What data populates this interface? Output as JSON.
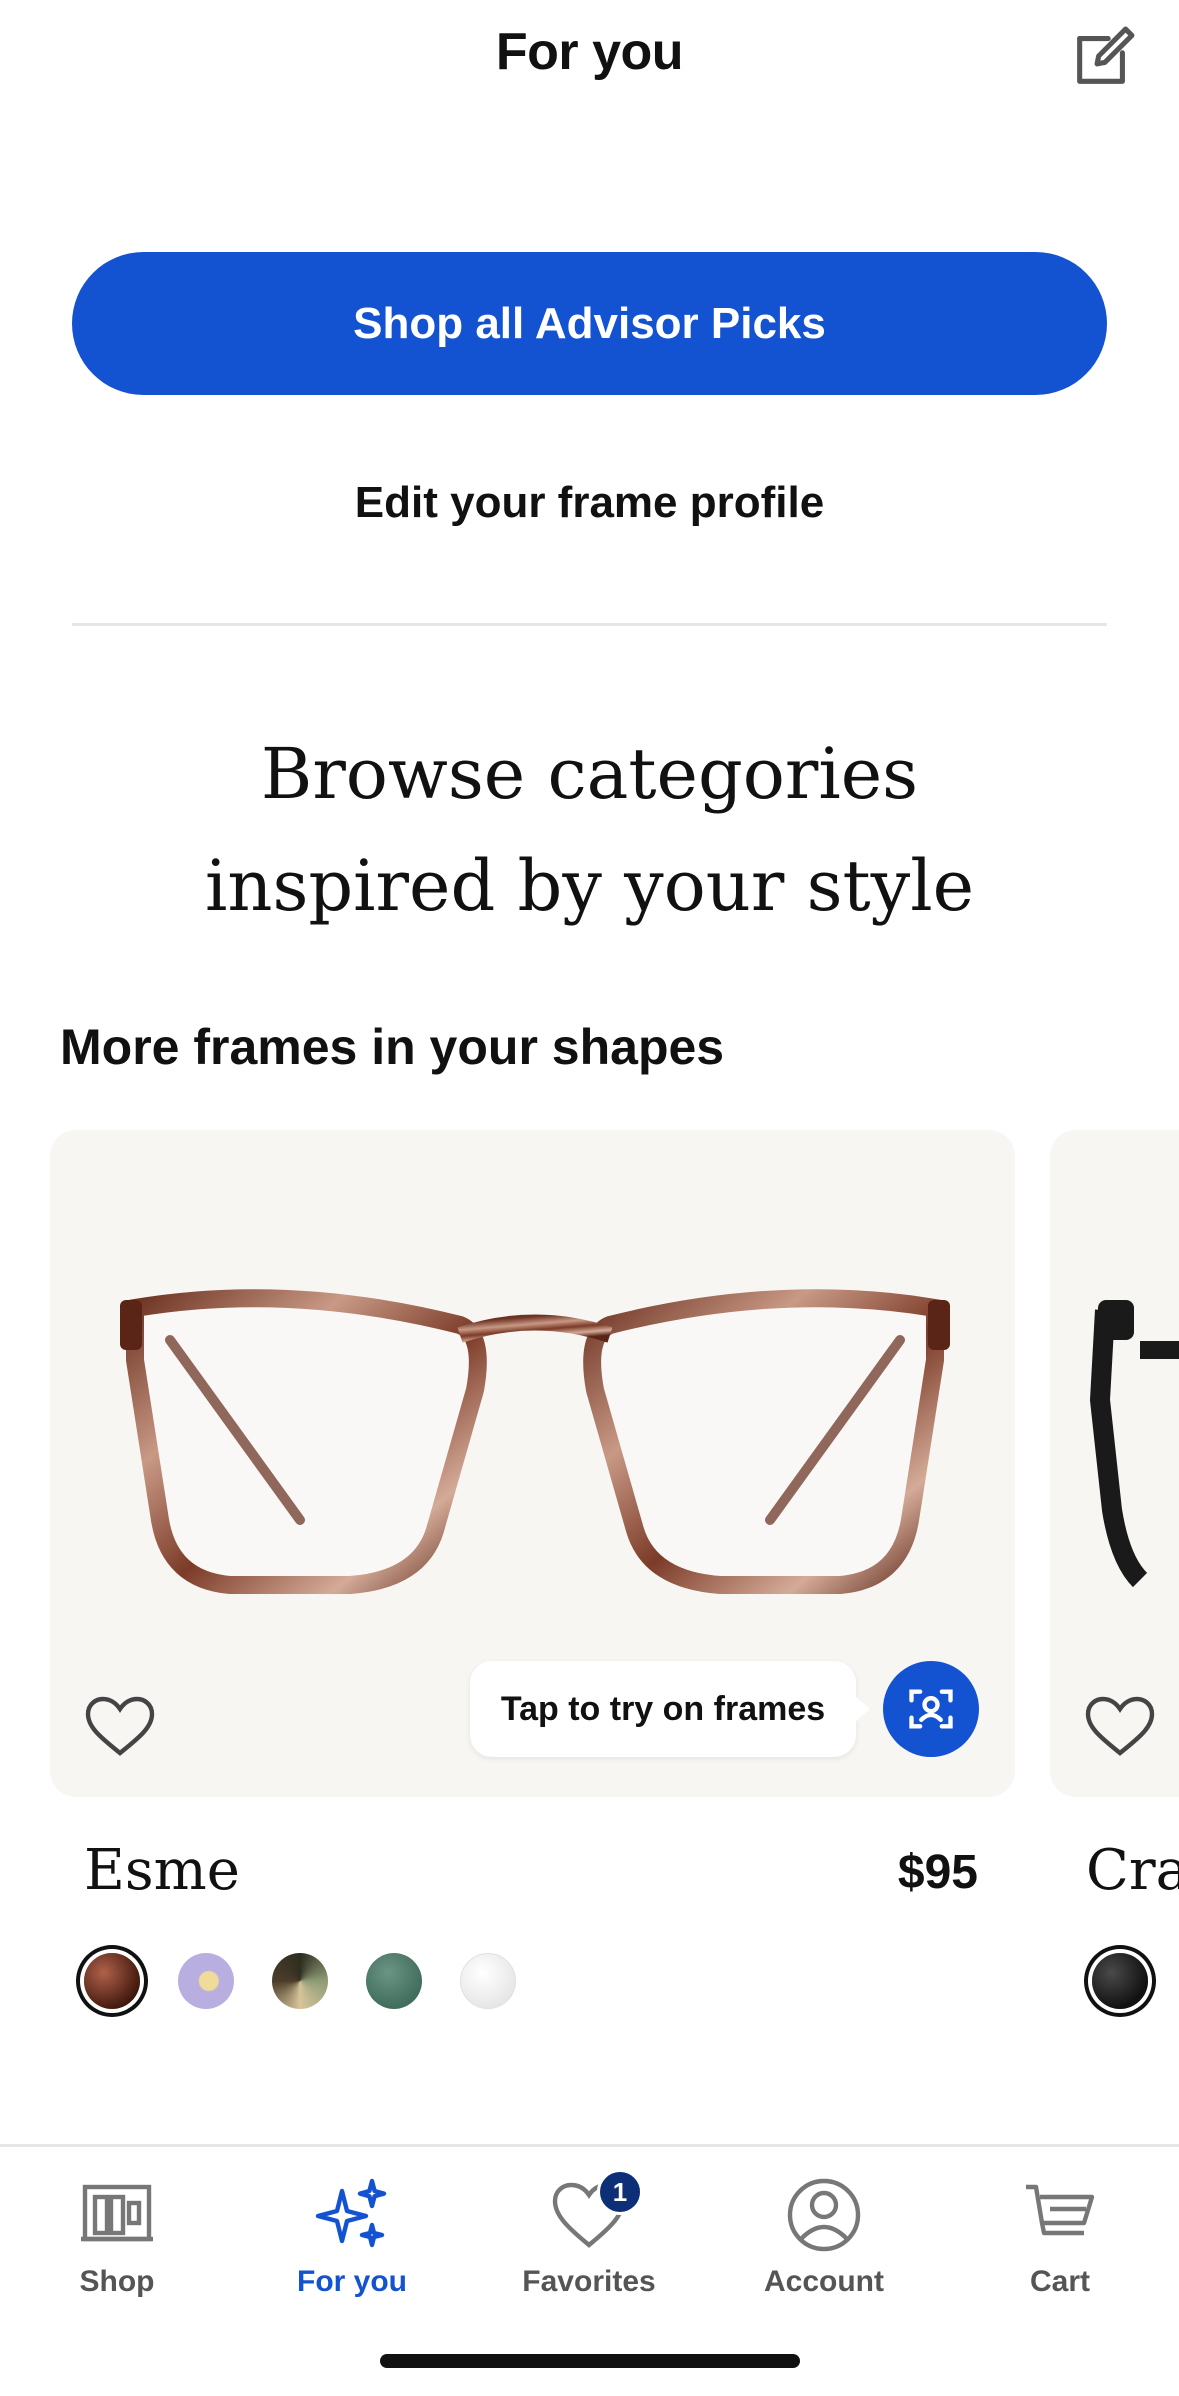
{
  "header": {
    "title": "For you",
    "edit_icon": "edit-icon"
  },
  "actions": {
    "shop_all_label": "Shop all Advisor Picks",
    "edit_profile_label": "Edit your frame profile"
  },
  "browse": {
    "title_line1": "Browse categories",
    "title_line2": "inspired by your style"
  },
  "section": {
    "title": "More frames in your shapes"
  },
  "products": [
    {
      "name": "Esme",
      "price": "$95",
      "tryon_tooltip": "Tap to try on frames",
      "swatches": [
        {
          "color": "#5a2516",
          "selected": true
        },
        {
          "color": "#b9aee0",
          "selected": false
        },
        {
          "color": "#7a6a4a",
          "selected": false
        },
        {
          "color": "#4f7d69",
          "selected": false
        },
        {
          "color": "#efefef",
          "selected": false
        }
      ]
    },
    {
      "name": "Cra",
      "swatches": [
        {
          "color": "#111111",
          "selected": true
        }
      ]
    }
  ],
  "tabbar": {
    "items": [
      {
        "label": "Shop",
        "icon": "shop-icon",
        "active": false
      },
      {
        "label": "For you",
        "icon": "sparkle-icon",
        "active": true
      },
      {
        "label": "Favorites",
        "icon": "heart-icon",
        "active": false,
        "badge": "1"
      },
      {
        "label": "Account",
        "icon": "account-icon",
        "active": false
      },
      {
        "label": "Cart",
        "icon": "cart-icon",
        "active": false
      }
    ]
  },
  "colors": {
    "accent": "#1352d1",
    "badge": "#0c2f78",
    "card_bg": "#f8f6f3"
  }
}
